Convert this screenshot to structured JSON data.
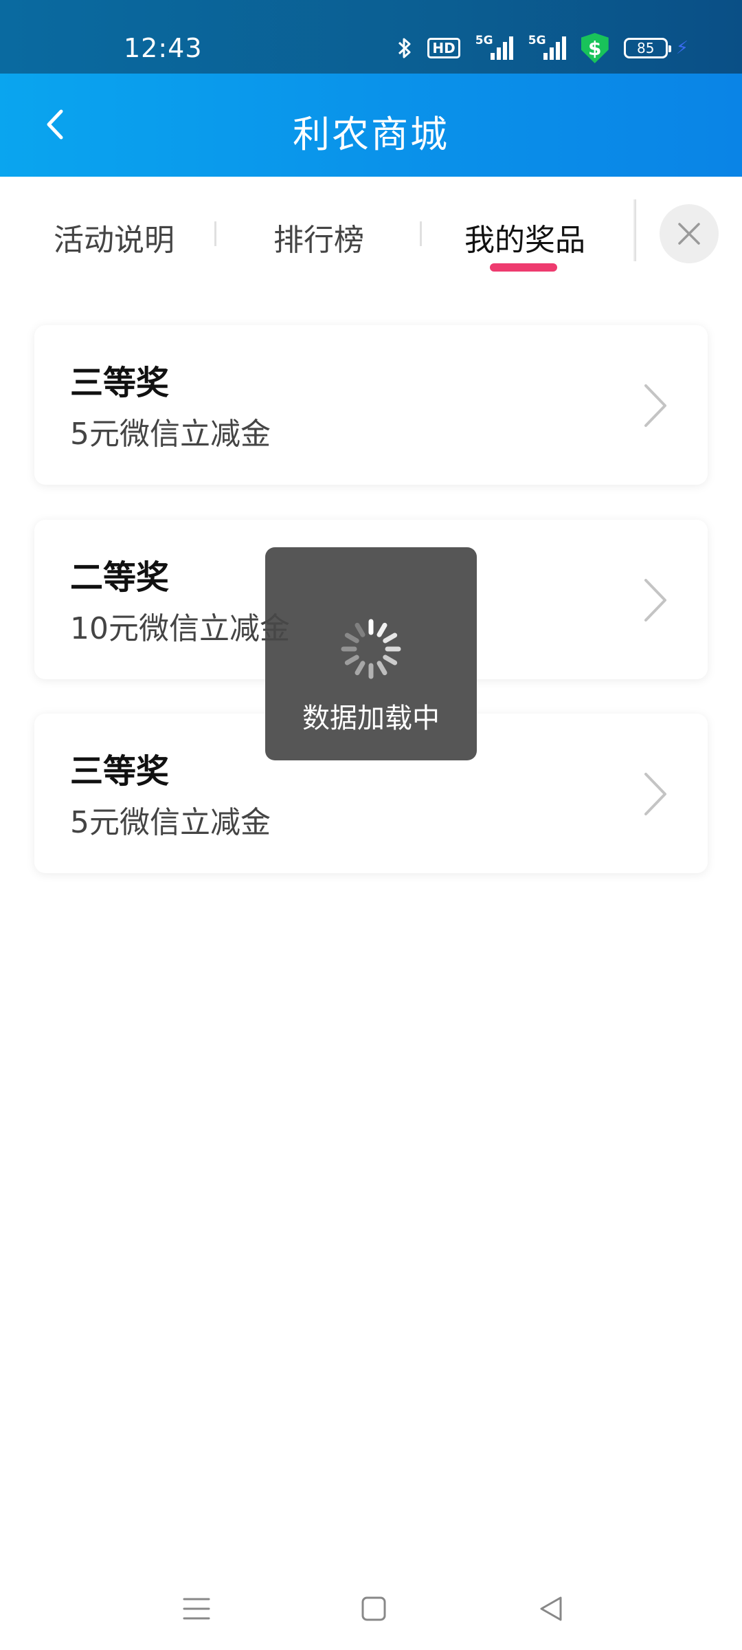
{
  "status_bar": {
    "time": "12:43",
    "hd_label": "HD",
    "signal1_label": "5G",
    "signal2_label": "5G",
    "security_symbol": "$",
    "battery_level": "85",
    "icons": [
      "bluetooth-icon",
      "hd-icon",
      "signal-5g-icon",
      "signal-5g-icon",
      "security-shield-icon",
      "battery-icon",
      "charging-icon"
    ]
  },
  "app_bar": {
    "title": "利农商城",
    "back_icon": "chevron-left-icon"
  },
  "tabs": {
    "items": [
      {
        "label": "活动说明",
        "active": false
      },
      {
        "label": "排行榜",
        "active": false
      },
      {
        "label": "我的奖品",
        "active": true
      }
    ],
    "active_color": "#ee3b6f",
    "close_icon": "close-icon"
  },
  "prizes": [
    {
      "level": "三等奖",
      "description": "5元微信立减金"
    },
    {
      "level": "二等奖",
      "description": "10元微信立减金"
    },
    {
      "level": "三等奖",
      "description": "5元微信立减金"
    }
  ],
  "loading_toast": {
    "text": "数据加载中"
  },
  "nav_bar": {
    "icons": [
      "menu-icon",
      "home-icon",
      "back-triangle-icon"
    ]
  },
  "colors": {
    "app_bar": "#0a93ea",
    "status_bar": "#0b5e92",
    "accent": "#ee3b6f"
  }
}
